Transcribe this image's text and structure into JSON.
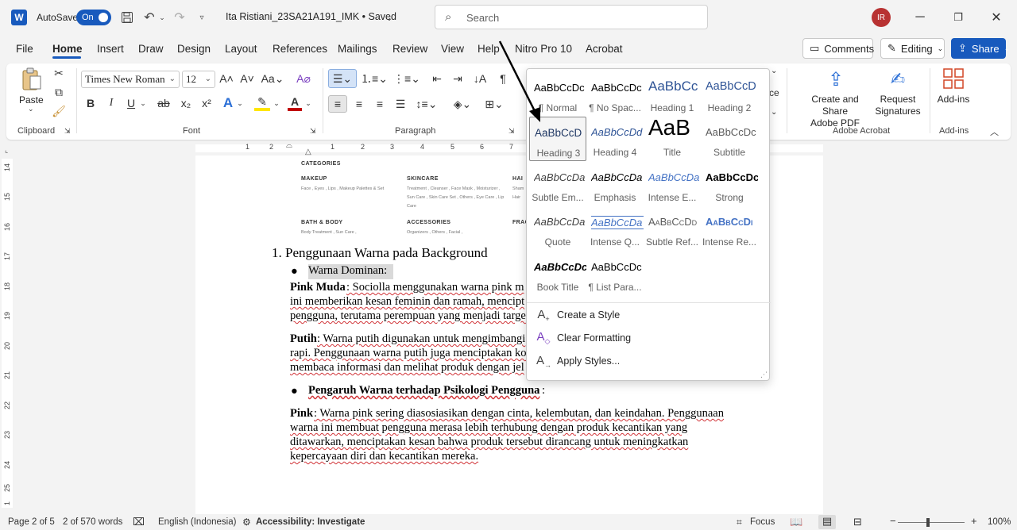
{
  "titlebar": {
    "autosave_label": "AutoSave",
    "autosave_state": "On",
    "document_title": "Ita Ristiani_23SA21A191_IMK • Saved",
    "search_placeholder": "Search",
    "user_initials": "IR"
  },
  "menu": {
    "tabs": [
      "File",
      "Home",
      "Insert",
      "Draw",
      "Design",
      "Layout",
      "References",
      "Mailings",
      "Review",
      "View",
      "Help",
      "Nitro Pro 10",
      "Acrobat"
    ],
    "comments": "Comments",
    "editing": "Editing",
    "share": "Share"
  },
  "ribbon": {
    "clipboard": {
      "paste": "Paste",
      "group": "Clipboard"
    },
    "font": {
      "name": "Times New Roman",
      "size": "12",
      "group": "Font"
    },
    "paragraph": {
      "group": "Paragraph"
    },
    "acrobat": {
      "create_share": "Create and Share",
      "adobe_pdf": "Adobe PDF",
      "request": "Request",
      "signatures": "Signatures",
      "group": "Adobe Acrobat"
    },
    "addins": {
      "label": "Add-ins",
      "group": "Add-ins"
    },
    "partial_styles_text": "ce"
  },
  "ruler": {
    "h_marks": [
      "1",
      "2",
      "1",
      "2",
      "3",
      "4",
      "5",
      "6",
      "7",
      "8"
    ],
    "v_marks": [
      "14",
      "15",
      "16",
      "17",
      "18",
      "19",
      "20",
      "21",
      "22",
      "23",
      "24",
      "25",
      "1"
    ]
  },
  "document": {
    "image": {
      "title": "CATEGORIES",
      "columns": [
        {
          "head": "MAKEUP",
          "text": "Face , Eyes , Lips , Makeup Palettes & Set"
        },
        {
          "head": "SKINCARE",
          "text": "Treatment , Cleanser , Face Mask , Moisturizer , Sun Care , Skin Care Set , Others , Eye Care , Lip Care"
        },
        {
          "head": "HAI",
          "text": "Sham Hair"
        },
        {
          "head": "BATH & BODY",
          "text": "Body Treatment , Sun Care ,"
        },
        {
          "head": "ACCESSORIES",
          "text": "Organizers , Others , Facial ,"
        },
        {
          "head": "FRAG",
          "text": ""
        }
      ]
    },
    "heading1": "1. Penggunaan Warna pada Background",
    "bullet1": "Warna Dominan:",
    "p1_bold": "Pink Muda",
    "p1_line1": ": Sociolla menggunakan warna pink m",
    "p1_line2": "ini memberikan kesan feminin dan ramah, mencipt",
    "p1_line3": "pengguna, terutama perempuan yang menjadi targe",
    "p2_bold": "Putih",
    "p2_line1": ": Warna putih digunakan untuk mengimbangi",
    "p2_line2": "rapi. Penggunaan warna putih juga menciptakan ko",
    "p2_line3": "membaca informasi dan melihat produk dengan jel",
    "bullet2": "Pengaruh Warna terhadap Psikologi Pengguna",
    "bullet2_suffix": ":",
    "p3_bold": "Pink",
    "p3_line1": ": Warna pink sering diasosiasikan dengan cinta, kelembutan, dan keindahan. Penggunaan",
    "p3_line2": "warna ini membuat pengguna merasa lebih terhubung dengan produk kecantikan yang",
    "p3_line3": "ditawarkan, menciptakan kesan bahwa produk tersebut dirancang untuk meningkatkan",
    "p3_line4": "kepercayaan diri dan kecantikan mereka."
  },
  "styles_gallery": {
    "styles": [
      {
        "sample": "AaBbCcDc",
        "name": "¶ Normal"
      },
      {
        "sample": "AaBbCcDc",
        "name": "¶ No Spac..."
      },
      {
        "sample": "AaBbCc",
        "name": "Heading 1"
      },
      {
        "sample": "AaBbCcD",
        "name": "Heading 2"
      },
      {
        "sample": "AaBbCcD",
        "name": "Heading 3"
      },
      {
        "sample": "AaBbCcDd",
        "name": "Heading 4"
      },
      {
        "sample": "AaB",
        "name": "Title"
      },
      {
        "sample": "AaBbCcDc",
        "name": "Subtitle"
      },
      {
        "sample": "AaBbCcDa",
        "name": "Subtle Em..."
      },
      {
        "sample": "AaBbCcDa",
        "name": "Emphasis"
      },
      {
        "sample": "AaBbCcDa",
        "name": "Intense E..."
      },
      {
        "sample": "AaBbCcDc",
        "name": "Strong"
      },
      {
        "sample": "AaBbCcDa",
        "name": "Quote"
      },
      {
        "sample": "AaBbCcDa",
        "name": "Intense Q..."
      },
      {
        "sample": "AaBbCcDd",
        "name": "Subtle Ref..."
      },
      {
        "sample": "AaBbCcDi",
        "name": "Intense Re..."
      },
      {
        "sample": "AaBbCcDc",
        "name": "Book Title"
      },
      {
        "sample": "AaBbCcDc",
        "name": "¶ List Para..."
      }
    ],
    "selected": "Heading 3",
    "actions": {
      "create": "Create a Style",
      "clear": "Clear Formatting",
      "apply": "Apply Styles..."
    }
  },
  "statusbar": {
    "page": "Page 2 of 5",
    "words": "2 of 570 words",
    "language": "English (Indonesia)",
    "accessibility": "Accessibility: Investigate",
    "focus": "Focus",
    "zoom": "100%",
    "zoom_level": 1.0
  },
  "colors": {
    "accent": "#185abd",
    "heading_blue": "#2f5496",
    "intense_blue": "#4472c4",
    "squiggle": "#d13438"
  }
}
